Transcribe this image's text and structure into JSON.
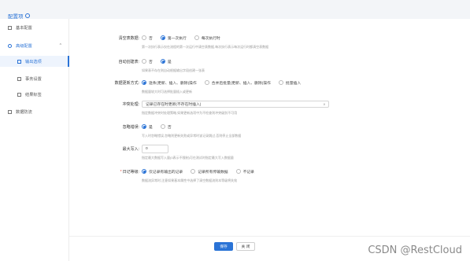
{
  "header": {
    "title": "配置项"
  },
  "sidebar": {
    "items": [
      {
        "label": "基本配置"
      },
      {
        "label": "高级配置"
      },
      {
        "label": "输出选项"
      },
      {
        "label": "事务设置"
      },
      {
        "label": "结果标签"
      },
      {
        "label": "数据防流"
      }
    ]
  },
  "form": {
    "truncate": {
      "label": "清空表数据:",
      "options": [
        "否",
        "第一次执行",
        "每次执行时"
      ],
      "selected": 1,
      "hint": "第一次执行表示仅在流程的第一次运行中清空表数据,每次执行表示每次运行时都清空表数据"
    },
    "auto_create": {
      "label": "自动创建表:",
      "options": [
        "否",
        "是"
      ],
      "selected": 1,
      "hint": "如果表不存在则自动根据输出字段创建一张表"
    },
    "update_mode": {
      "label": "数据更新方式:",
      "options": [
        "逐条(更新、插入、删除)操作",
        "合并后批量(更新、插入、删除)操作",
        "批量插入"
      ],
      "selected": 0,
      "hint": "数据量较大时可选择批量插入或更新"
    },
    "conflict": {
      "label": "冲突处理:",
      "value": "记录已存在时更新(不存在时插入)",
      "hint": "指定数据冲突时处理策略,如果更新选项中为不检查则冲突级别不可用"
    },
    "ignore_err": {
      "label": "忽略错误:",
      "options": [
        "是",
        "否"
      ],
      "selected": 0,
      "hint": "写入时忽略错误,忽略则更新失败或异常时该记录跳过,否则停止全部数据"
    },
    "max_write": {
      "label": "最大写入:",
      "value": "0",
      "hint": "指定最大数据写入量(0表示不限制)可在测试时指定最大写入数据量"
    },
    "log": {
      "label": "日记等级:",
      "options": [
        "仅记录有输出的记录",
        "记录所有传输数据",
        "不记录"
      ],
      "selected": 0,
      "hint": "数据流异常时,注意如果基本属性中选择了清空数据流则本等级将失效"
    }
  },
  "footer": {
    "save_label": "保存",
    "close_label": "关 闭"
  },
  "watermark": "CSDN @RestCloud",
  "colors": {
    "accent": "#2a73d6"
  }
}
